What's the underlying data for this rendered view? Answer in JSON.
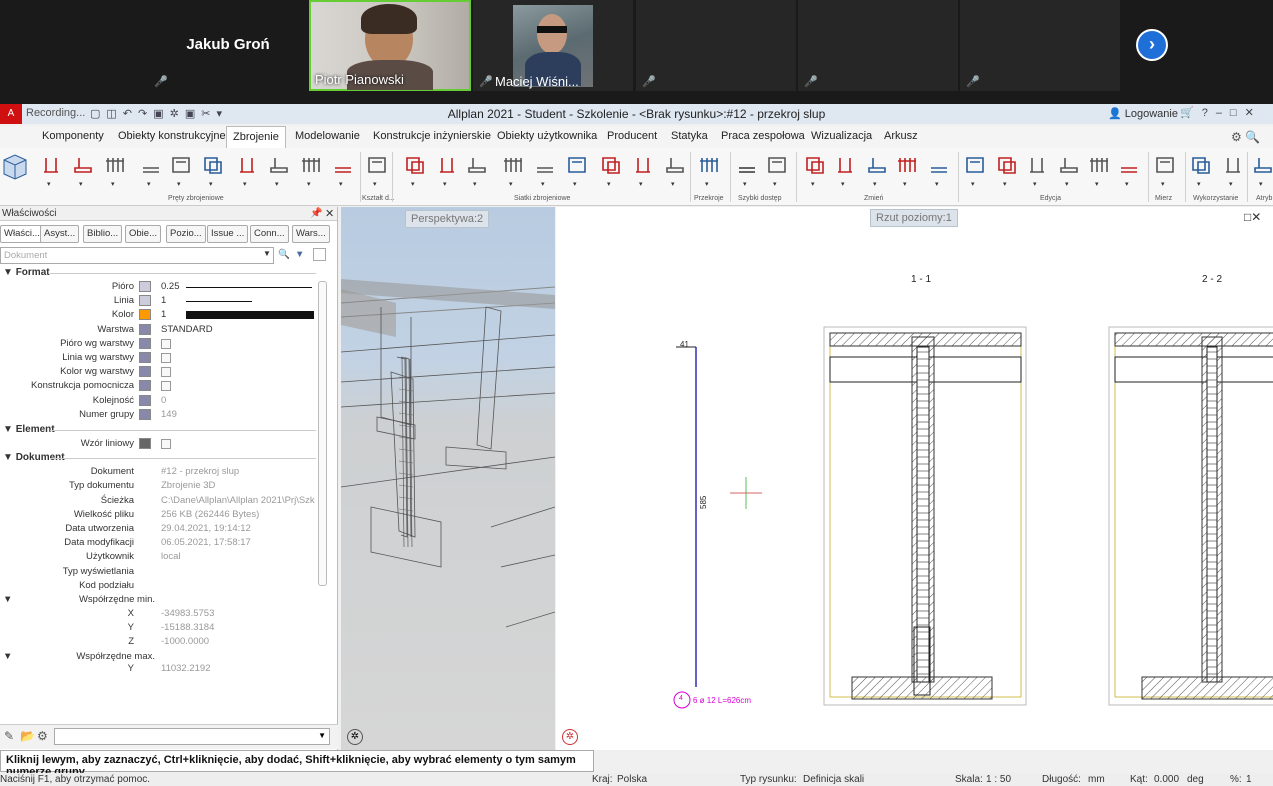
{
  "zoom": {
    "participants": [
      {
        "name": "Jakub Groń"
      },
      {
        "name": "Piotr Pianowski"
      },
      {
        "name": "Maciej Wiśni..."
      }
    ],
    "rec_label": "Recording..."
  },
  "app": {
    "title": "Allplan 2021 - Student - Szkolenie - <Brak rysunku>:#12 - przekroj slup",
    "login": "Logowanie",
    "menus": [
      "Komponenty",
      "Obiekty konstrukcyjne",
      "Zbrojenie",
      "Modelowanie",
      "Konstrukcje inżynierskie",
      "Obiekty użytkownika",
      "Producent",
      "Statyka",
      "Praca zespołowa",
      "Wizualizacja",
      "Arkusz"
    ],
    "active_menu": "Zbrojenie",
    "groups": [
      "Pręty zbrojeniowe",
      "Kształt d...",
      "Siatki zbrojeniowe",
      "Przekroje",
      "Szybki dostęp",
      "Zmień",
      "Edycja",
      "Mierz",
      "Wykorzystanie",
      "Atryb"
    ]
  },
  "props": {
    "title": "Właściwości",
    "tabs": [
      "Właści...",
      "Asyst...",
      "Biblio...",
      "Obie...",
      "Pozio...",
      "Issue ...",
      "Conn...",
      "Wars..."
    ],
    "dropdown": "Dokument",
    "sections": {
      "format": "Format",
      "element": "Element",
      "dokument": "Dokument"
    },
    "format_rows": [
      {
        "label": "Pióro",
        "value": "0.25"
      },
      {
        "label": "Linia",
        "value": "1"
      },
      {
        "label": "Kolor",
        "value": "1"
      },
      {
        "label": "Warstwa",
        "value": "STANDARD"
      },
      {
        "label": "Pióro wg warstwy",
        "value": ""
      },
      {
        "label": "Linia wg warstwy",
        "value": ""
      },
      {
        "label": "Kolor wg warstwy",
        "value": ""
      },
      {
        "label": "Konstrukcja pomocnicza",
        "value": ""
      },
      {
        "label": "Kolejność",
        "value": "0"
      },
      {
        "label": "Numer grupy",
        "value": "149"
      }
    ],
    "element_rows": [
      {
        "label": "Wzór liniowy",
        "value": ""
      }
    ],
    "dokument_rows": [
      {
        "label": "Dokument",
        "value": "#12 - przekroj slup"
      },
      {
        "label": "Typ dokumentu",
        "value": "Zbrojenie 3D"
      },
      {
        "label": "Ścieżka",
        "value": "C:\\Dane\\Allplan\\Allplan 2021\\Prj\\Szk"
      },
      {
        "label": "Wielkość pliku",
        "value": "256 KB (262446 Bytes)"
      },
      {
        "label": "Data utworzenia",
        "value": "29.04.2021, 19:14:12"
      },
      {
        "label": "Data modyfikacji",
        "value": "06.05.2021, 17:58:17"
      },
      {
        "label": "Użytkownik",
        "value": "local"
      },
      {
        "label": "Typ wyświetlania",
        "value": ""
      },
      {
        "label": "Kod podziału",
        "value": ""
      }
    ],
    "coord_min_label": "Współrzędne min.",
    "coord_min": [
      {
        "label": "X",
        "value": "-34983.5753"
      },
      {
        "label": "Y",
        "value": "-15188.3184"
      },
      {
        "label": "Z",
        "value": "-1000.0000"
      }
    ],
    "coord_max_label": "Współrzędne max.",
    "coord_max_first": {
      "label": "Y",
      "value": "11032.2192"
    }
  },
  "views": {
    "perspective": "Perspektywa:2",
    "plan": "Rzut poziomy:1",
    "section1": "1 - 1",
    "section2": "2 - 2",
    "dim_top": "41",
    "dim_side": "585",
    "bar_no": "4",
    "bar_label": "6 ø 12 L=626cm"
  },
  "hint": "Kliknij lewym, aby zaznaczyć, Ctrl+kliknięcie, aby dodać, Shift+kliknięcie, aby wybrać elementy o tym samym numerze grupy",
  "status": {
    "help": "Naciśnij F1, aby otrzymać pomoc.",
    "kraj_l": "Kraj:",
    "kraj": "Polska",
    "typ_l": "Typ rysunku:",
    "typ": "Definicja skali",
    "skala_l": "Skala:",
    "skala": "1 : 50",
    "dl_l": "Długość:",
    "dl": "mm",
    "kat_l": "Kąt:",
    "kat": "0.000",
    "kat_u": "deg",
    "pct_l": "%:",
    "pct": "1"
  },
  "colors": {
    "accent": "#1f6fd8",
    "rebar": "#555555",
    "dim_pink": "#d800d8",
    "dim_blue": "#2222aa"
  }
}
